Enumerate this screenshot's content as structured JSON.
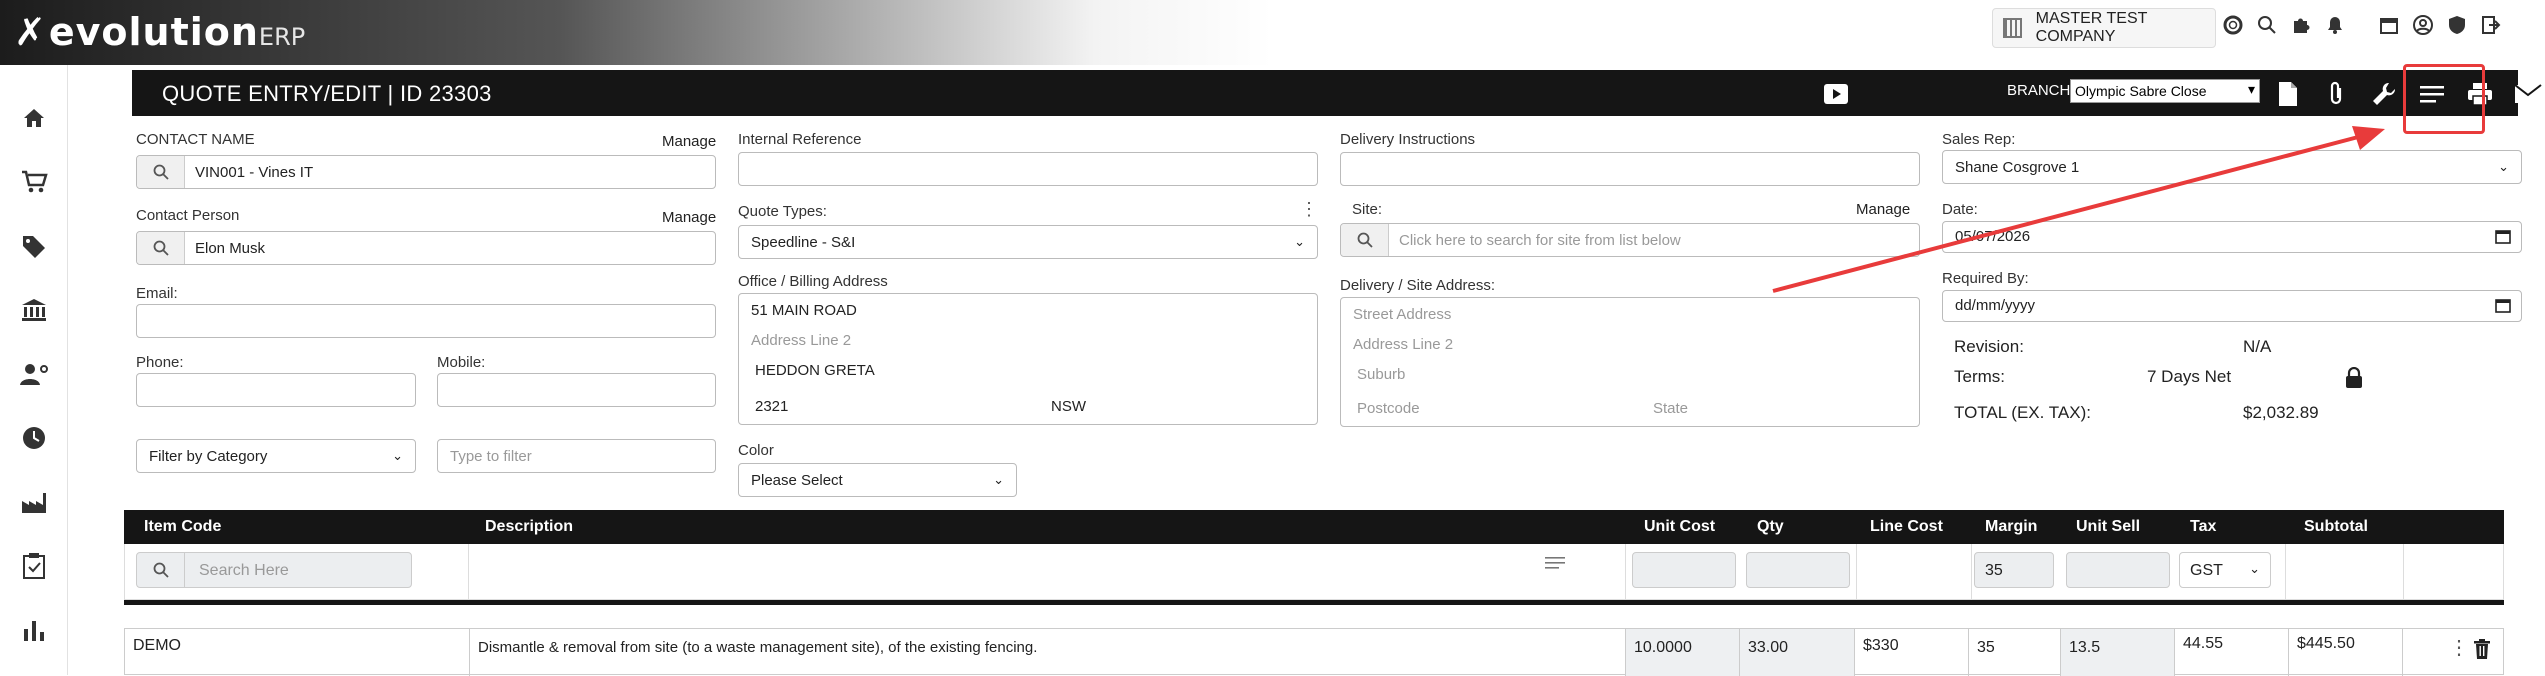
{
  "app": {
    "logo_main": "evolution",
    "logo_suffix": "ERP"
  },
  "topbar": {
    "company": "MASTER TEST COMPANY",
    "icons": [
      "company-building-icon",
      "support-lifebuoy-icon",
      "search-icon",
      "puzzle-icon",
      "bell-icon",
      "calendar-icon",
      "user-profile-icon",
      "shield-icon",
      "logout-icon"
    ]
  },
  "sidebar": {
    "items": [
      "home-icon",
      "cart-icon",
      "tag-icon",
      "bank-icon",
      "user-settings-icon",
      "clock-icon",
      "factory-icon",
      "clipboard-check-icon",
      "bar-chart-icon"
    ]
  },
  "header": {
    "title": "QUOTE ENTRY/EDIT | ID 23303",
    "branch_label": "BRANCH",
    "branch_value": "Olympic Sabre Close",
    "buttons": [
      "play-icon",
      "document-icon",
      "paperclip-icon",
      "wrench-icon",
      "list-icon",
      "printer-icon",
      "mail-icon",
      "cash-register-icon",
      "save-icon"
    ]
  },
  "form": {
    "contact_name_label": "CONTACT NAME",
    "contact_name_value": "VIN001 - Vines IT",
    "manage": "Manage",
    "contact_person_label": "Contact Person",
    "contact_person_value": "Elon Musk",
    "email_label": "Email:",
    "phone_label": "Phone:",
    "mobile_label": "Mobile:",
    "filter_category": "Filter by Category",
    "type_to_filter": "Type to filter",
    "internal_ref_label": "Internal Reference",
    "quote_types_label": "Quote Types:",
    "quote_types_value": "Speedline - S&I",
    "office_billing_label": "Office / Billing Address",
    "billing": {
      "line1": "51 MAIN ROAD",
      "line2_placeholder": "Address Line 2",
      "suburb": "HEDDON GRETA",
      "postcode": "2321",
      "state": "NSW"
    },
    "color_label": "Color",
    "color_value": "Please Select",
    "delivery_instructions_label": "Delivery Instructions",
    "site_label": "Site:",
    "site_placeholder": "Click here to search for site from list below",
    "delivery_site_label": "Delivery / Site Address:",
    "delivery": {
      "street_placeholder": "Street Address",
      "line2_placeholder": "Address Line 2",
      "suburb_placeholder": "Suburb",
      "postcode_placeholder": "Postcode",
      "state_placeholder": "State"
    },
    "sales_rep_label": "Sales Rep:",
    "sales_rep_value": "Shane Cosgrove 1",
    "date_label": "Date:",
    "date_value": "05/07/2026",
    "required_by_label": "Required By:",
    "required_by_value": "dd/mm/yyyy",
    "revision_label": "Revision:",
    "revision_value": "N/A",
    "terms_label": "Terms:",
    "terms_value": "7 Days Net",
    "total_label": "TOTAL (EX. TAX):",
    "total_value": "$2,032.89"
  },
  "table": {
    "columns": [
      "Item Code",
      "Description",
      "Unit Cost",
      "Qty",
      "Line Cost",
      "Margin",
      "Unit Sell",
      "Tax",
      "Subtotal"
    ],
    "search_placeholder": "Search Here",
    "default_margin": "35",
    "default_tax": "GST",
    "rows": [
      {
        "item_code": "DEMO",
        "description": "Dismantle & removal from site (to a waste management site), of the existing fencing.",
        "unit_cost": "10.0000",
        "qty": "33.00",
        "line_cost": "$330",
        "margin": "35",
        "unit_sell": "13.5",
        "tax": "44.55",
        "subtotal": "$445.50"
      }
    ]
  },
  "colors": {
    "header_bg": "#151515",
    "annotation": "#e83b3b"
  }
}
